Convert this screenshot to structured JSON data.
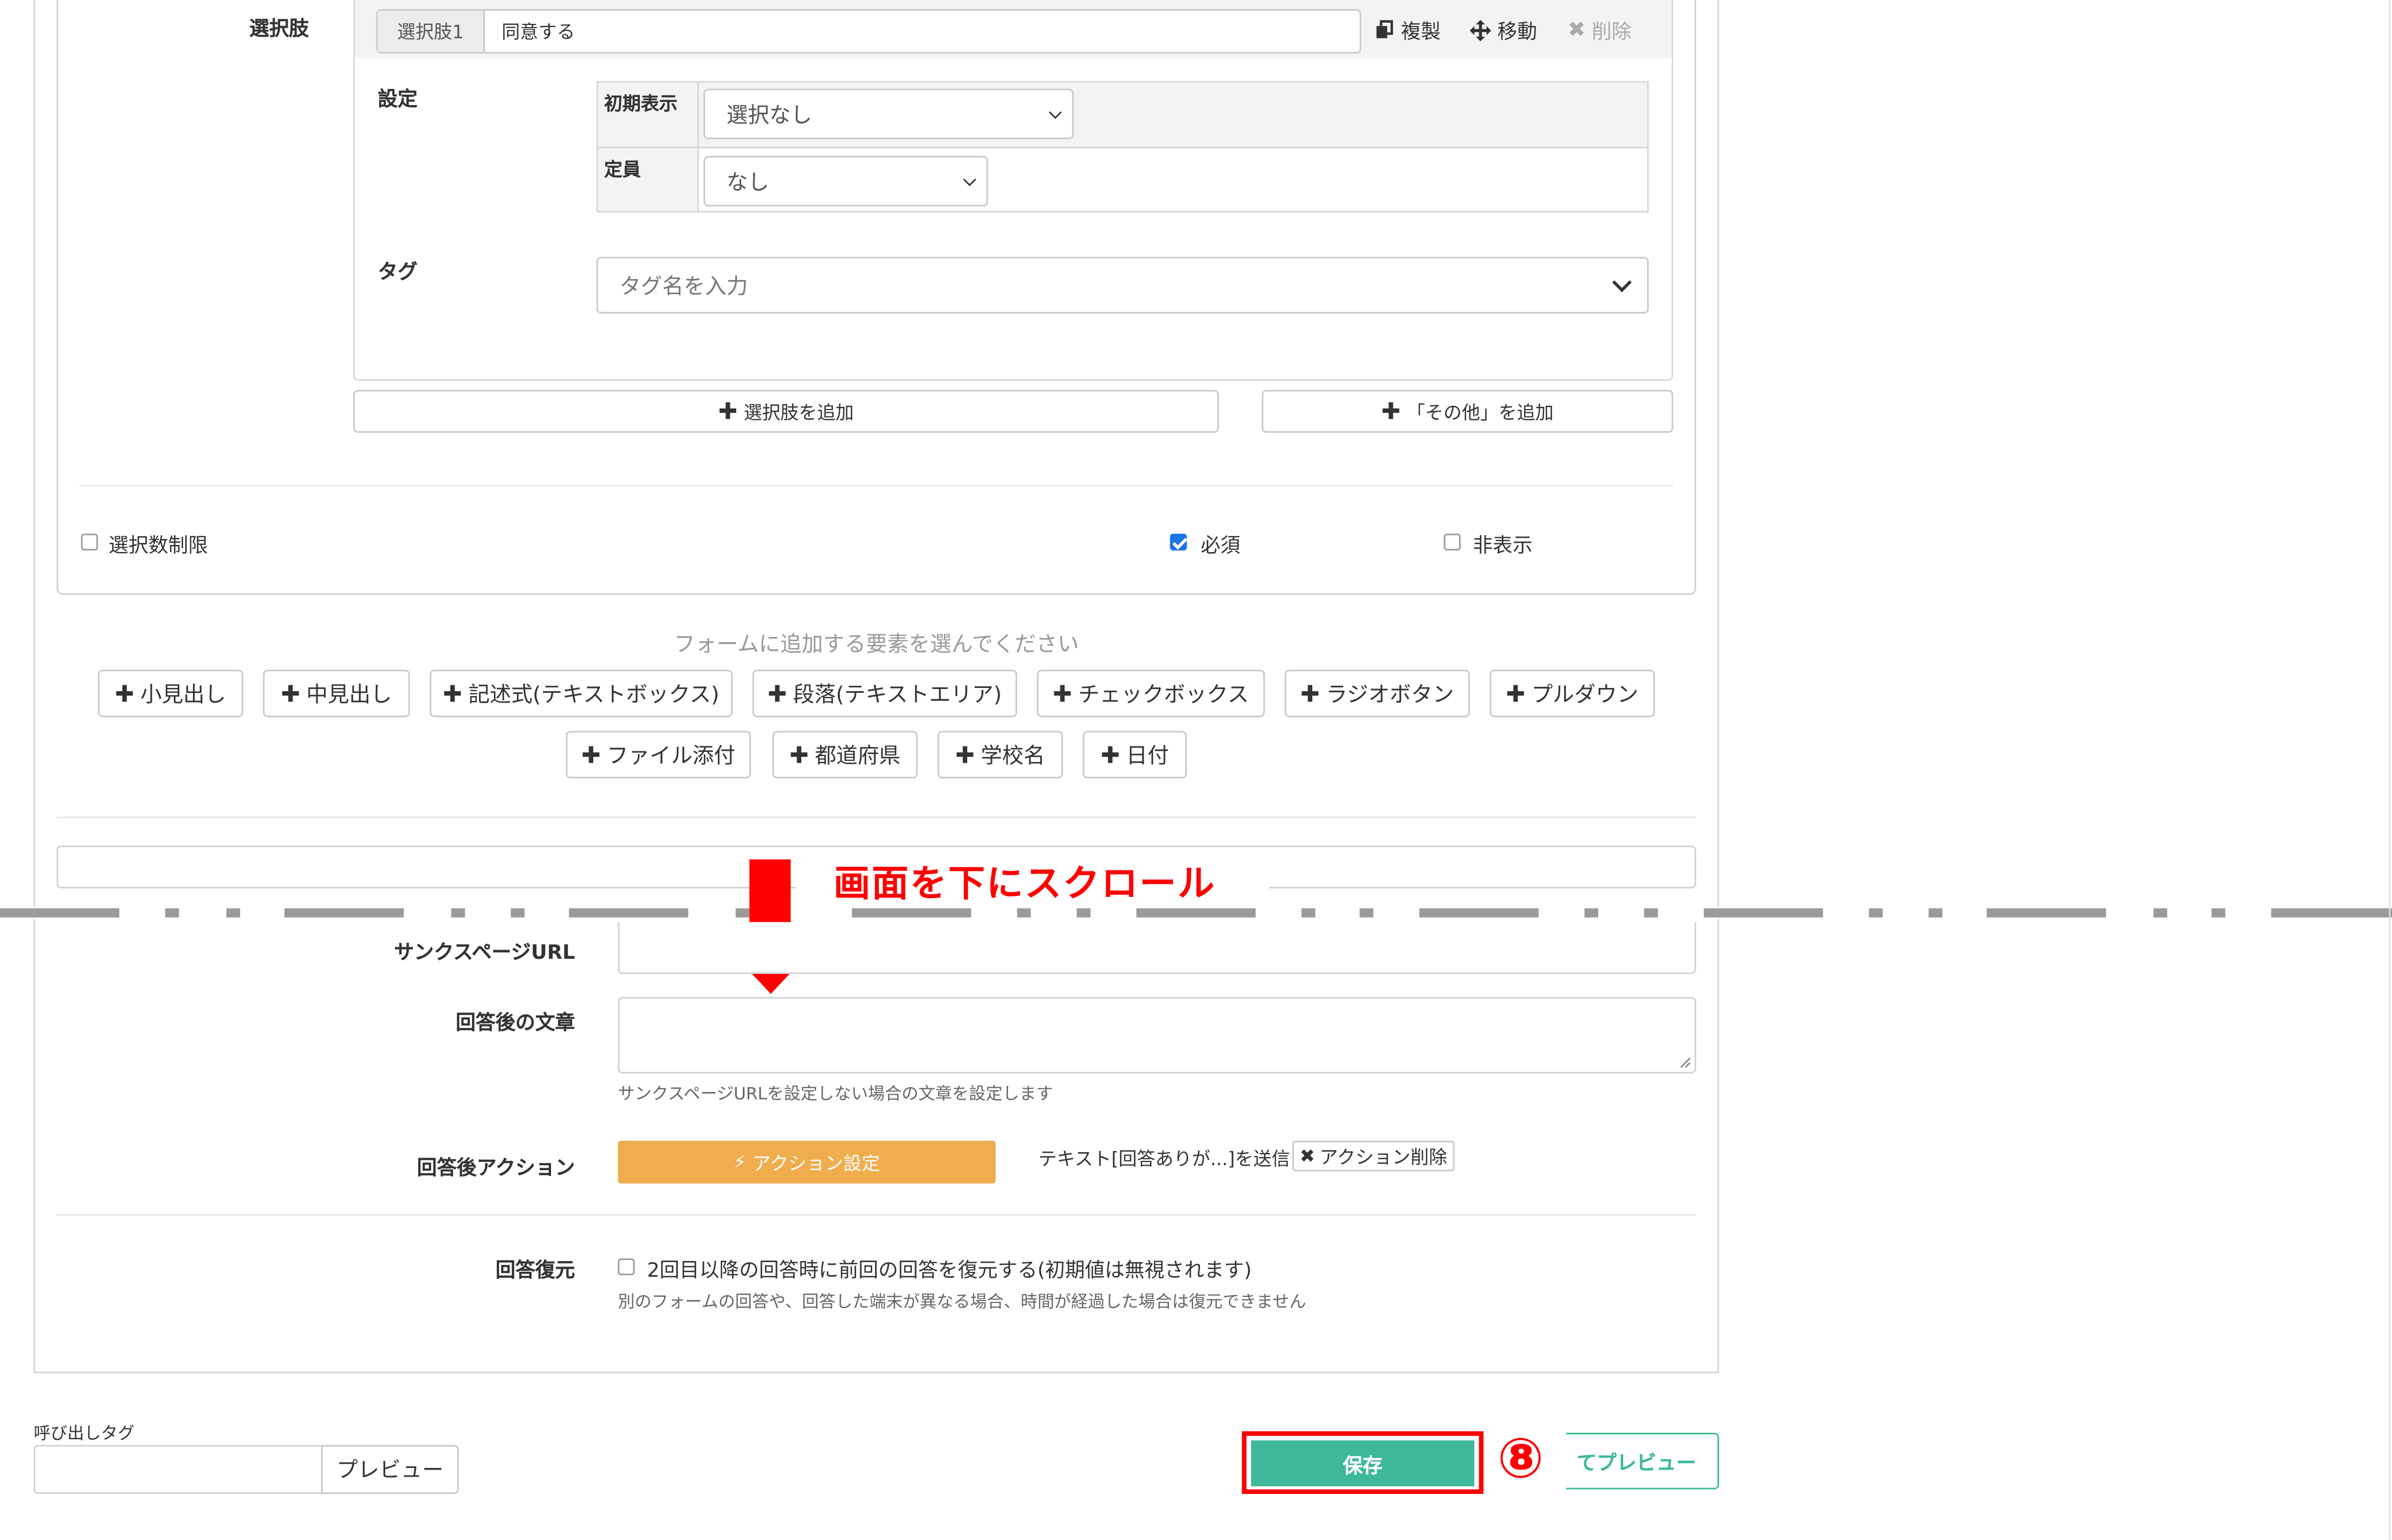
{
  "choice": {
    "section_label": "選択肢",
    "item_tag": "選択肢1",
    "item_value": "同意する",
    "duplicate_label": "複製",
    "move_label": "移動",
    "delete_label": "削除",
    "settings_label": "設定",
    "initial_display_label": "初期表示",
    "initial_display_value": "選択なし",
    "capacity_label": "定員",
    "capacity_value": "なし",
    "tag_label": "タグ",
    "tag_placeholder": "タグ名を入力",
    "add_choice_label": "選択肢を追加",
    "add_other_label": "「その他」を追加"
  },
  "options": {
    "limit_label": "選択数制限",
    "limit_checked": false,
    "required_label": "必須",
    "required_checked": true,
    "hidden_label": "非表示",
    "hidden_checked": false
  },
  "add_element": {
    "prompt": "フォームに追加する要素を選んでください",
    "buttons_row1": [
      "小見出し",
      "中見出し",
      "記述式(テキストボックス)",
      "段落(テキストエリア)",
      "チェックボックス",
      "ラジオボタン",
      "プルダウン"
    ],
    "buttons_row2": [
      "ファイル添付",
      "都道府県",
      "学校名",
      "日付"
    ]
  },
  "annotation": {
    "scroll_text": "画面を下にスクロール",
    "step_marker": "⑧",
    "colors": {
      "red": "#ff0000",
      "divider": "#9a9a9a"
    }
  },
  "form_settings": {
    "thanks_url_label": "サンクスページURL",
    "after_text_label": "回答後の文章",
    "after_text_help": "サンクスページURLを設定しない場合の文章を設定します",
    "after_action_label": "回答後アクション",
    "action_button_label": "アクション設定",
    "action_summary": "テキスト[回答ありが...]を送信",
    "action_delete_label": "アクション削除",
    "restore_label": "回答復元",
    "restore_checkbox_label": "2回目以降の回答時に前回の回答を復元する(初期値は無視されます)",
    "restore_checked": false,
    "restore_help": "別のフォームの回答や、回答した端末が異なる場合、時間が経過した場合は復元できません"
  },
  "footer": {
    "call_tag_label": "呼び出しタグ",
    "preview_label": "プレビュー",
    "save_label": "保存",
    "save_preview_label": "てプレビュー"
  },
  "colors": {
    "save_button": "#3db89a",
    "action_button": "#f0ad4e",
    "preview_outline": "#3db89a"
  }
}
